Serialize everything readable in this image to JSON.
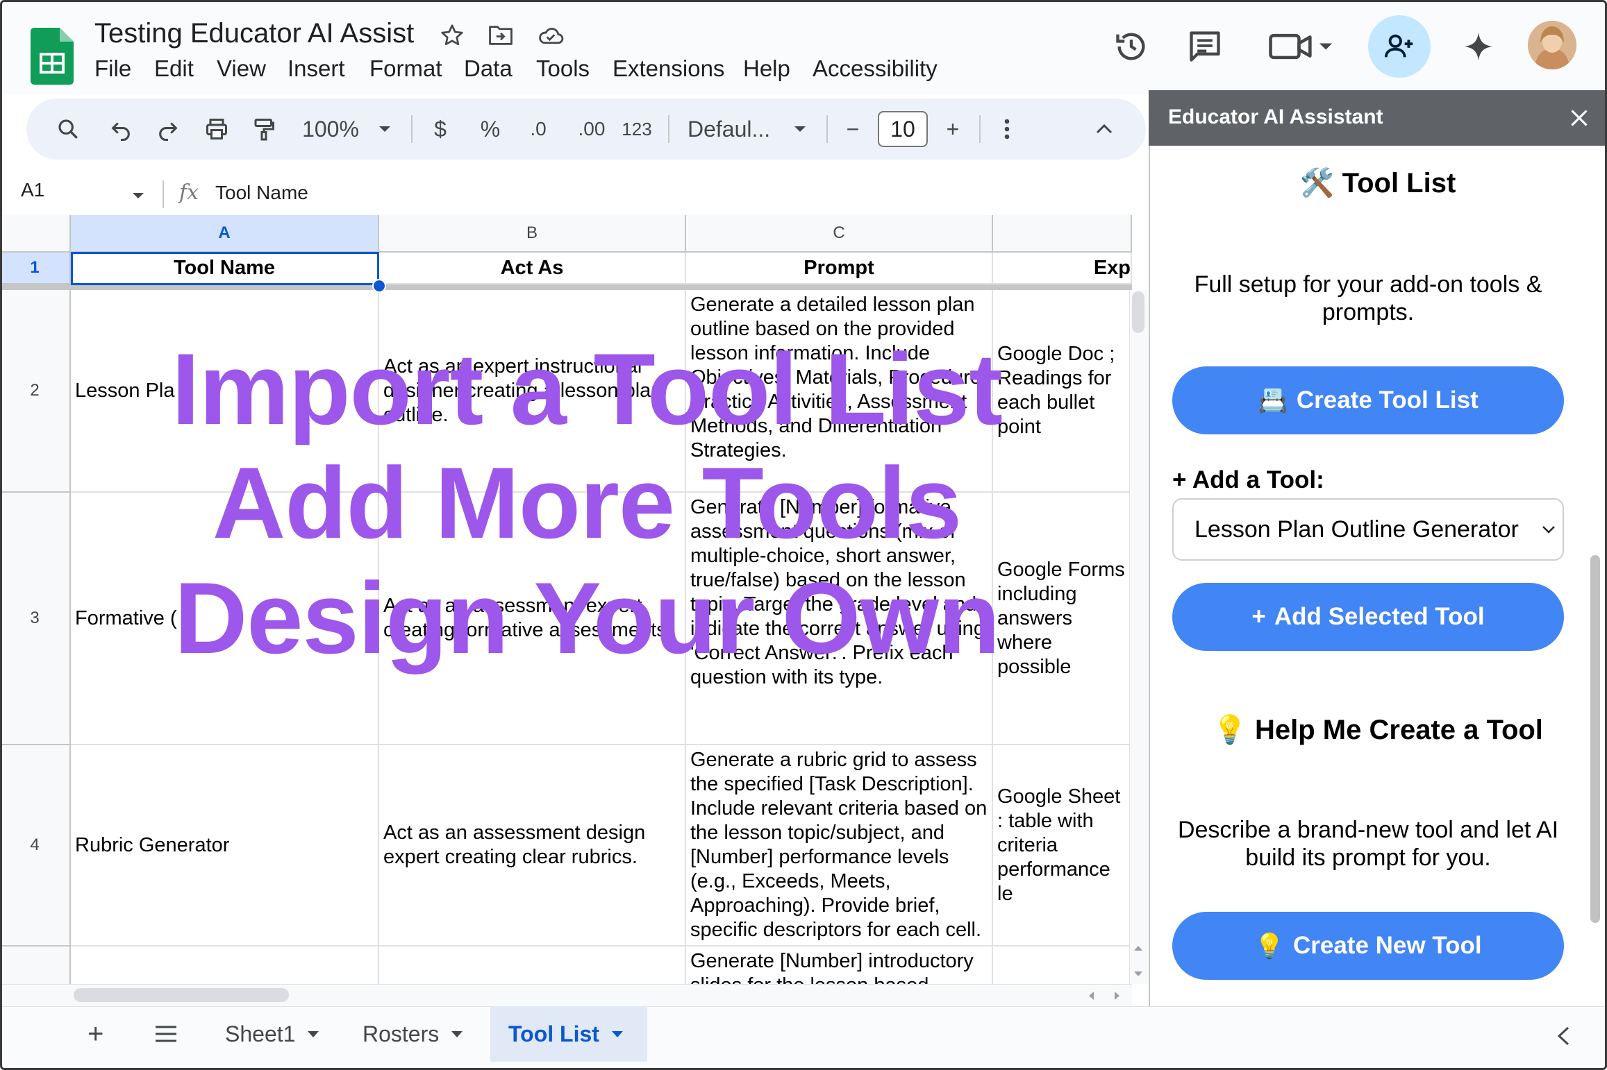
{
  "app": {
    "title": "Testing Educator AI Assist",
    "menu": [
      "File",
      "Edit",
      "View",
      "Insert",
      "Format",
      "Data",
      "Tools",
      "Extensions",
      "Help",
      "Accessibility"
    ]
  },
  "toolbar": {
    "zoom": "100%",
    "currency": "$",
    "percent": "%",
    "dec_decrease": ".0",
    "dec_increase": ".00",
    "number_format": "123",
    "font": "Defaul...",
    "font_size": "10",
    "minus": "−",
    "plus": "+"
  },
  "formula": {
    "cell_ref": "A1",
    "fx": "fx",
    "content": "Tool Name"
  },
  "grid": {
    "columns": [
      "A",
      "B",
      "C"
    ],
    "row_numbers": [
      "1",
      "2",
      "3",
      "4"
    ],
    "headers": [
      "Tool Name",
      "Act As",
      "Prompt",
      "Exp"
    ],
    "rows": [
      {
        "a": "Lesson Pla",
        "b": "Act as an expert instructional designer creating a lesson plan outline.",
        "c": "Generate a detailed lesson plan outline based on the provided lesson information. Include Objectives, Materials, Procedure, Practice Activities, Assessment Methods, and Differentiation Strategies.",
        "d": "Google Doc ; Readings for each bullet point"
      },
      {
        "a": "Formative (",
        "b": "Act as an assessment expert creating formative assessments.",
        "c": "Generate [Number] formative assessment questions (mix of multiple-choice, short answer, true/false) based on the lesson topic. Target the grade level and indicate the correct answer using 'Correct Answer:'. Prefix each question with its type.",
        "d": "Google Forms including answers where possible"
      },
      {
        "a": "Rubric Generator",
        "b": "Act as an assessment design expert creating clear rubrics.",
        "c": "Generate a rubric grid to assess the specified [Task Description]. Include relevant criteria based on the lesson topic/subject, and [Number] performance levels (e.g., Exceeds, Meets, Approaching). Provide brief, specific descriptors for each cell.",
        "d": "Google Sheet : table with criteria performance le"
      }
    ],
    "row5_prompt": "Generate [Number] introductory slides for the lesson based"
  },
  "overlay": {
    "line1": "Import a Tool List",
    "line2": "Add More Tools",
    "line3": "Design Your Own"
  },
  "sheets": {
    "add": "+",
    "tabs": [
      "Sheet1",
      "Rosters",
      "Tool List"
    ],
    "active": "Tool List"
  },
  "panel": {
    "title": "Educator AI Assistant",
    "tool_list_icon": "🛠️",
    "tool_list_heading": "Tool List",
    "setup_text": "Full setup for your add-on tools & prompts.",
    "create_list_icon": "📇",
    "create_list_btn": "Create Tool List",
    "add_tool_plus": "+",
    "add_tool_heading": "Add a Tool:",
    "selected_tool": "Lesson Plan Outline Generator",
    "add_selected_plus": "+",
    "add_selected_btn": "Add Selected Tool",
    "help_icon": "💡",
    "help_heading": "Help Me Create a Tool",
    "help_text": "Describe a brand-new tool and let AI build its prompt for you.",
    "create_new_icon": "💡",
    "create_new_btn": "Create New Tool"
  },
  "colors": {
    "overlay": "#9d57ea",
    "panel_button": "#4285f4",
    "panel_header": "#5f6368",
    "selection": "#0b57d0"
  }
}
